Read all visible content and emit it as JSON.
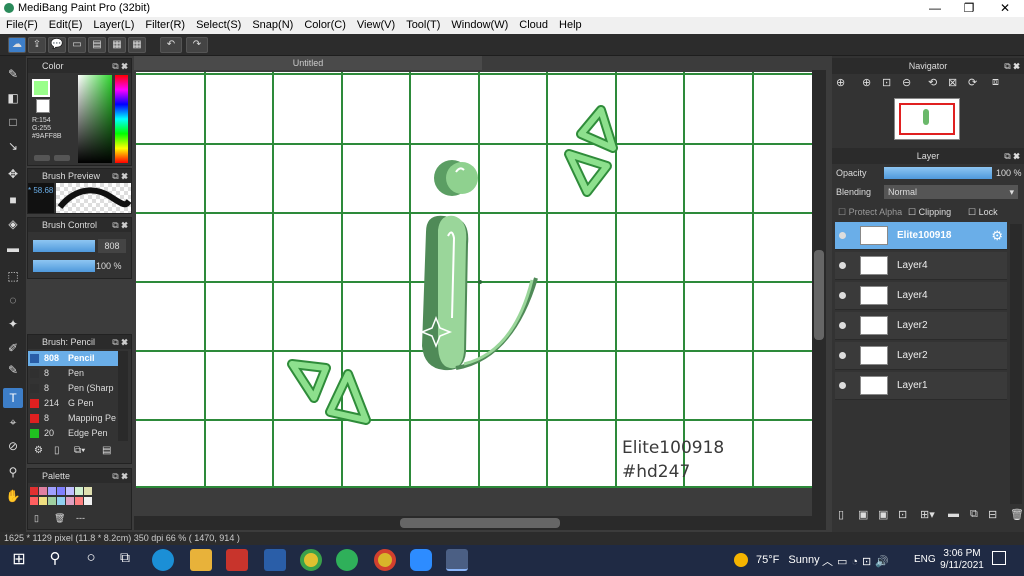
{
  "window": {
    "title": "MediBang Paint Pro (32bit)",
    "minimize": "—",
    "maximize": "❐",
    "close": "✕"
  },
  "menu": [
    "File(F)",
    "Edit(E)",
    "Layer(L)",
    "Filter(R)",
    "Select(S)",
    "Snap(N)",
    "Color(C)",
    "View(V)",
    "Tool(T)",
    "Window(W)",
    "Cloud",
    "Help"
  ],
  "canvas": {
    "tab_title": "Untitled",
    "text_line1": "Elite100918",
    "text_line2": "#hd247"
  },
  "color_panel": {
    "title": "Color",
    "r": "R:154",
    "g": "G:255",
    "hex": "#9AFF8B",
    "fg_color": "#9aff8b"
  },
  "brush_preview": {
    "title": "Brush Preview",
    "size": "* 58.68"
  },
  "brush_control": {
    "title": "Brush Control",
    "size_value": "808",
    "opacity_value": "100 %"
  },
  "brush_list": {
    "title": "Brush: Pencil",
    "items": [
      {
        "size": "808",
        "name": "Pencil",
        "color": "#2a5ea8",
        "selected": true
      },
      {
        "size": "8",
        "name": "Pen",
        "color": "#303030",
        "selected": false
      },
      {
        "size": "8",
        "name": "Pen (Sharp",
        "color": "#303030",
        "selected": false
      },
      {
        "size": "214",
        "name": "G Pen",
        "color": "#e02020",
        "selected": false
      },
      {
        "size": "8",
        "name": "Mapping Pe",
        "color": "#e02020",
        "selected": false
      },
      {
        "size": "20",
        "name": "Edge Pen",
        "color": "#20c020",
        "selected": false
      }
    ]
  },
  "palette": {
    "title": "Palette",
    "dash": "---"
  },
  "navigator": {
    "title": "Navigator"
  },
  "layer_panel": {
    "title": "Layer",
    "opacity_label": "Opacity",
    "opacity_value": "100 %",
    "blending_label": "Blending",
    "blending_value": "Normal",
    "protect_alpha": "Protect Alpha",
    "clipping": "Clipping",
    "lock": "Lock",
    "layers": [
      {
        "name": "Elite100918",
        "selected": true
      },
      {
        "name": "Layer4",
        "selected": false
      },
      {
        "name": "Layer4",
        "selected": false
      },
      {
        "name": "Layer2",
        "selected": false
      },
      {
        "name": "Layer2",
        "selected": false
      },
      {
        "name": "Layer1",
        "selected": false
      }
    ]
  },
  "status": {
    "text": "1625 * 1129 pixel  (11.8 * 8.2cm)  350 dpi  66 %  ( 1470, 914 )"
  },
  "taskbar": {
    "weather_temp": "75°F",
    "weather_desc": "Sunny",
    "lang": "ENG",
    "time": "3:06 PM",
    "date": "9/11/2021"
  }
}
